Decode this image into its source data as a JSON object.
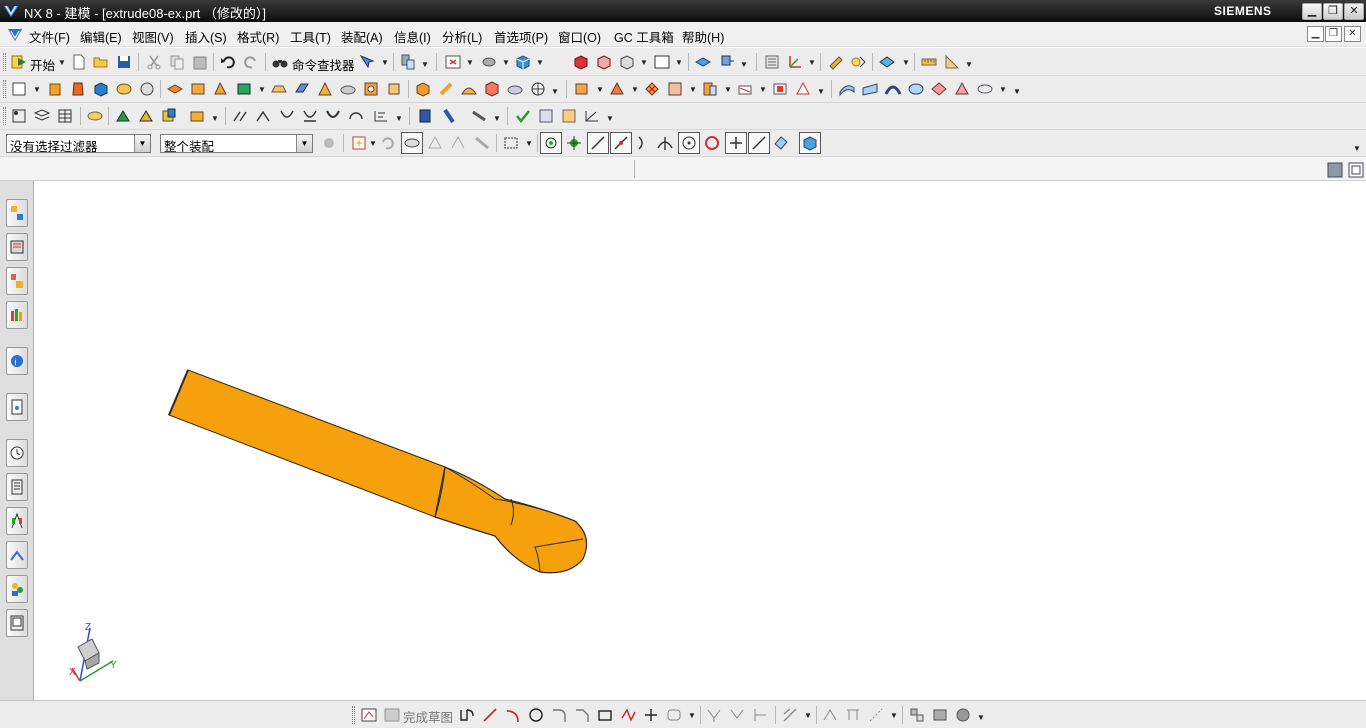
{
  "window": {
    "title": "NX 8 - 建模 - [extrude08-ex.prt （修改的）]",
    "brand": "SIEMENS",
    "controls": [
      "minimize",
      "restore",
      "close"
    ]
  },
  "menu": {
    "items": [
      {
        "label": "文件(F)",
        "icon": "none"
      },
      {
        "label": "编辑(E)"
      },
      {
        "label": "视图(V)"
      },
      {
        "label": "插入(S)"
      },
      {
        "label": "格式(R)"
      },
      {
        "label": "工具(T)"
      },
      {
        "label": "装配(A)"
      },
      {
        "label": "信息(I)"
      },
      {
        "label": "分析(L)"
      },
      {
        "label": "首选项(P)"
      },
      {
        "label": "窗口(O)"
      },
      {
        "label": "GC 工具箱"
      },
      {
        "label": "帮助(H)"
      }
    ]
  },
  "toolbar1": {
    "start_label": "开始",
    "command_finder_label": "命令查找器"
  },
  "selection": {
    "filter_value": "没有选择过滤器",
    "scope_value": "整个装配"
  },
  "bottom_toolbar": {
    "finish_sketch_label": "完成草图"
  },
  "triad": {
    "z_label": "Z",
    "y_label": "Y",
    "x_label": "X"
  },
  "colors": {
    "model_fill": "#f5a00c",
    "model_edge": "#2a2a2a",
    "titlebar": "#1a1a1a"
  }
}
